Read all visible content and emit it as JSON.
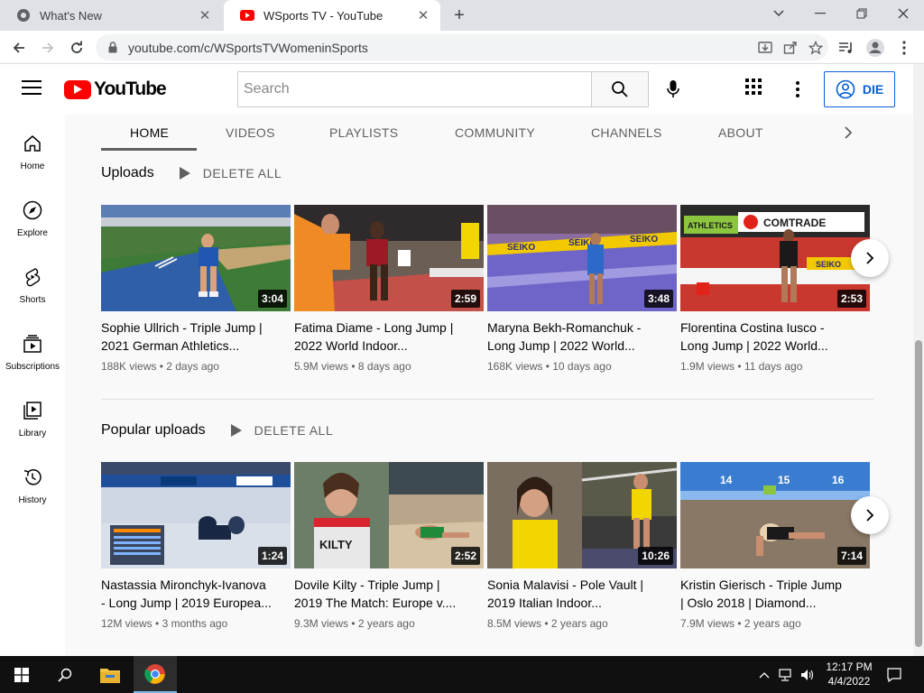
{
  "browser": {
    "tabs": [
      {
        "title": "What's New",
        "active": false
      },
      {
        "title": "WSports TV - YouTube",
        "active": true
      }
    ],
    "url": "youtube.com/c/WSportsTVWomeninSports"
  },
  "header": {
    "logo_text": "YouTube",
    "search_placeholder": "Search",
    "signin_label": "DIE"
  },
  "guide": [
    {
      "label": "Home",
      "icon": "home-icon"
    },
    {
      "label": "Explore",
      "icon": "compass-icon"
    },
    {
      "label": "Shorts",
      "icon": "shorts-icon"
    },
    {
      "label": "Subscriptions",
      "icon": "subscriptions-icon"
    },
    {
      "label": "Library",
      "icon": "library-icon"
    },
    {
      "label": "History",
      "icon": "history-icon"
    }
  ],
  "channel_tabs": [
    "HOME",
    "VIDEOS",
    "PLAYLISTS",
    "COMMUNITY",
    "CHANNELS",
    "ABOUT"
  ],
  "shelves": [
    {
      "title": "Uploads",
      "play_all": "DELETE ALL",
      "videos": [
        {
          "title_line1": "Sophie Ullrich - Triple Jump |",
          "title_line2": "2021 German Athletics...",
          "views": "188K views",
          "age": "2 days ago",
          "duration": "3:04"
        },
        {
          "title_line1": "Fatima Diame - Long Jump |",
          "title_line2": "2022 World Indoor...",
          "views": "5.9M views",
          "age": "8 days ago",
          "duration": "2:59"
        },
        {
          "title_line1": "Maryna Bekh-Romanchuk -",
          "title_line2": "Long Jump | 2022 World...",
          "views": "168K views",
          "age": "10 days ago",
          "duration": "3:48"
        },
        {
          "title_line1": "Florentina Costina Iusco -",
          "title_line2": "Long Jump | 2022 World...",
          "views": "1.9M views",
          "age": "11 days ago",
          "duration": "2:53"
        }
      ]
    },
    {
      "title": "Popular uploads",
      "play_all": "DELETE ALL",
      "videos": [
        {
          "title_line1": "Nastassia Mironchyk-Ivanova",
          "title_line2": "- Long Jump | 2019 Europea...",
          "views": "12M views",
          "age": "3 months ago",
          "duration": "1:24"
        },
        {
          "title_line1": "Dovile Kilty - Triple Jump |",
          "title_line2": "2019 The Match: Europe v....",
          "views": "9.3M views",
          "age": "2 years ago",
          "duration": "2:52"
        },
        {
          "title_line1": "Sonia Malavisi - Pole Vault |",
          "title_line2": "2019 Italian Indoor...",
          "views": "8.5M views",
          "age": "2 years ago",
          "duration": "10:26"
        },
        {
          "title_line1": "Kristin Gierisch - Triple Jump",
          "title_line2": "| Oslo 2018 | Diamond...",
          "views": "7.9M views",
          "age": "2 years ago",
          "duration": "7:14"
        }
      ]
    }
  ],
  "thumb_text": {
    "bib": "KILTY",
    "board1": "SEIKO",
    "board2": "ATHLETICS",
    "board3": "COMTRADE",
    "scale": [
      "14",
      "15",
      "16"
    ]
  },
  "taskbar": {
    "time": "12:17 PM",
    "date": "4/4/2022"
  },
  "colors": {
    "brand_red": "#ff0000",
    "link_blue": "#065fd4"
  }
}
